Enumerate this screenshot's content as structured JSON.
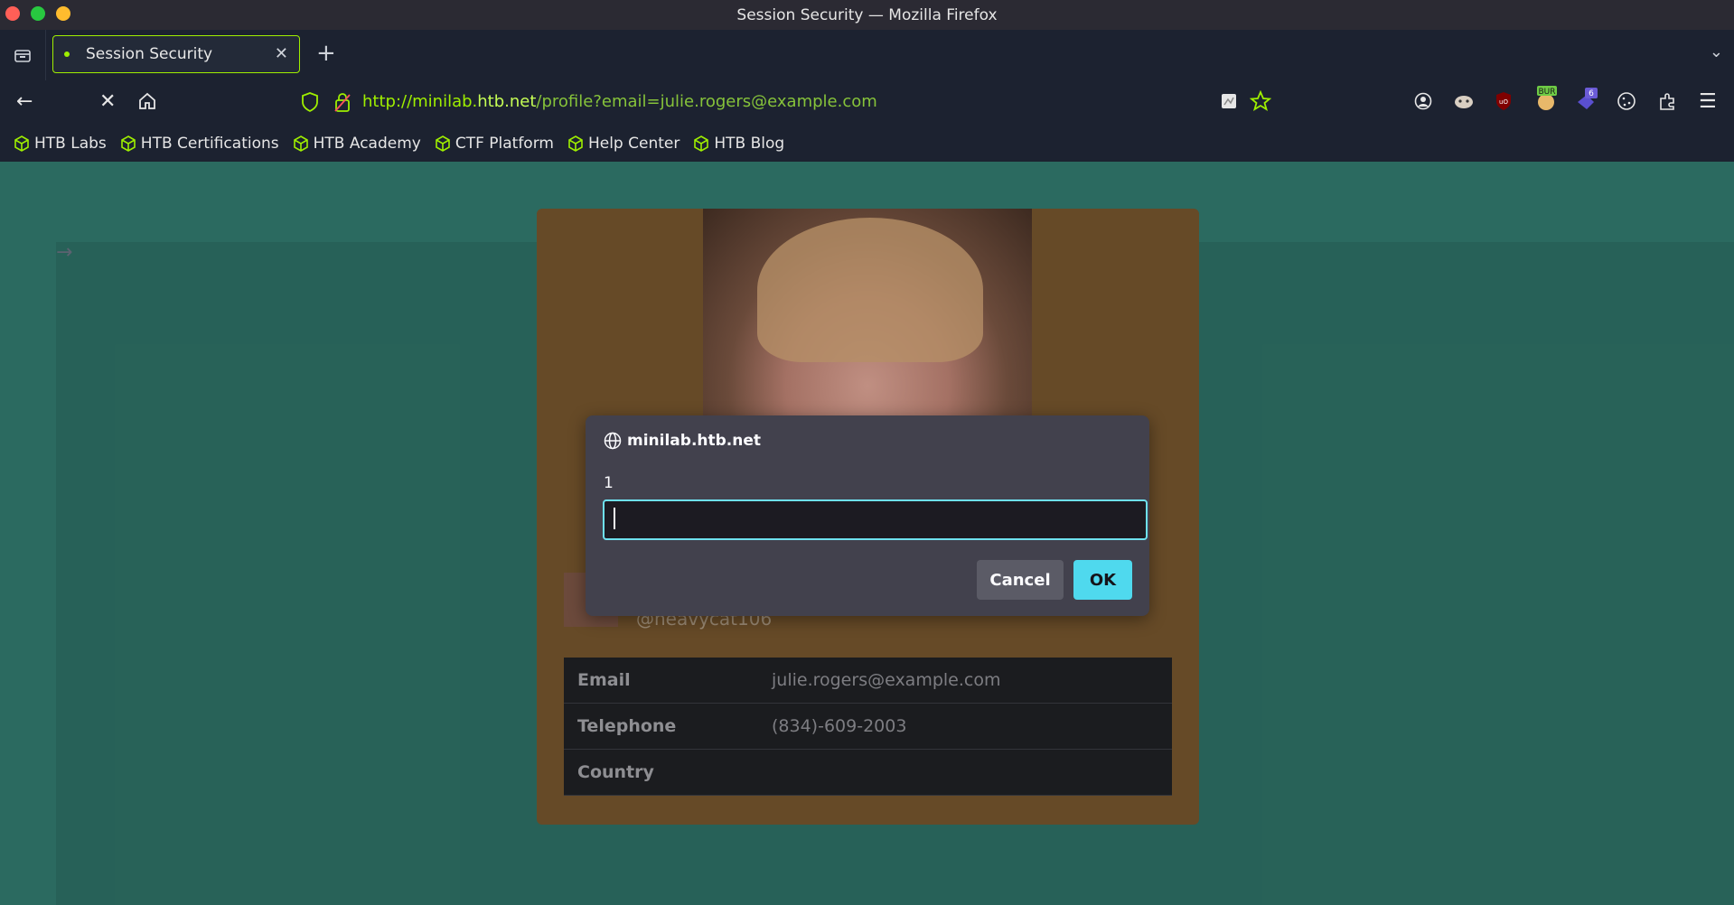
{
  "window": {
    "title": "Session Security — Mozilla Firefox"
  },
  "tabs": [
    {
      "label": "Session Security",
      "active": true
    }
  ],
  "navbar": {
    "url_prefix": "http://minilab.",
    "url_host": "htb.net",
    "url_path": "/profile?email=julie.rogers@example.com"
  },
  "bookmarks": [
    "HTB Labs",
    "HTB Certifications",
    "HTB Academy",
    "CTF Platform",
    "Help Center",
    "HTB Blog"
  ],
  "extensions": {
    "burp_badge": "BUR",
    "notification_count": "6"
  },
  "profile": {
    "handle": "@heavycat106",
    "rows": [
      {
        "label": "Email",
        "value": "julie.rogers@example.com"
      },
      {
        "label": "Telephone",
        "value": "(834)-609-2003"
      },
      {
        "label": "Country",
        "value": ""
      }
    ]
  },
  "dialog": {
    "origin": "minilab.htb.net",
    "message": "1",
    "input_value": "",
    "cancel_label": "Cancel",
    "ok_label": "OK"
  },
  "colors": {
    "accent": "#9fef00",
    "page_bg": "#2b6a60",
    "card_bg": "#664a27",
    "ok_button": "#4fd9ee"
  }
}
